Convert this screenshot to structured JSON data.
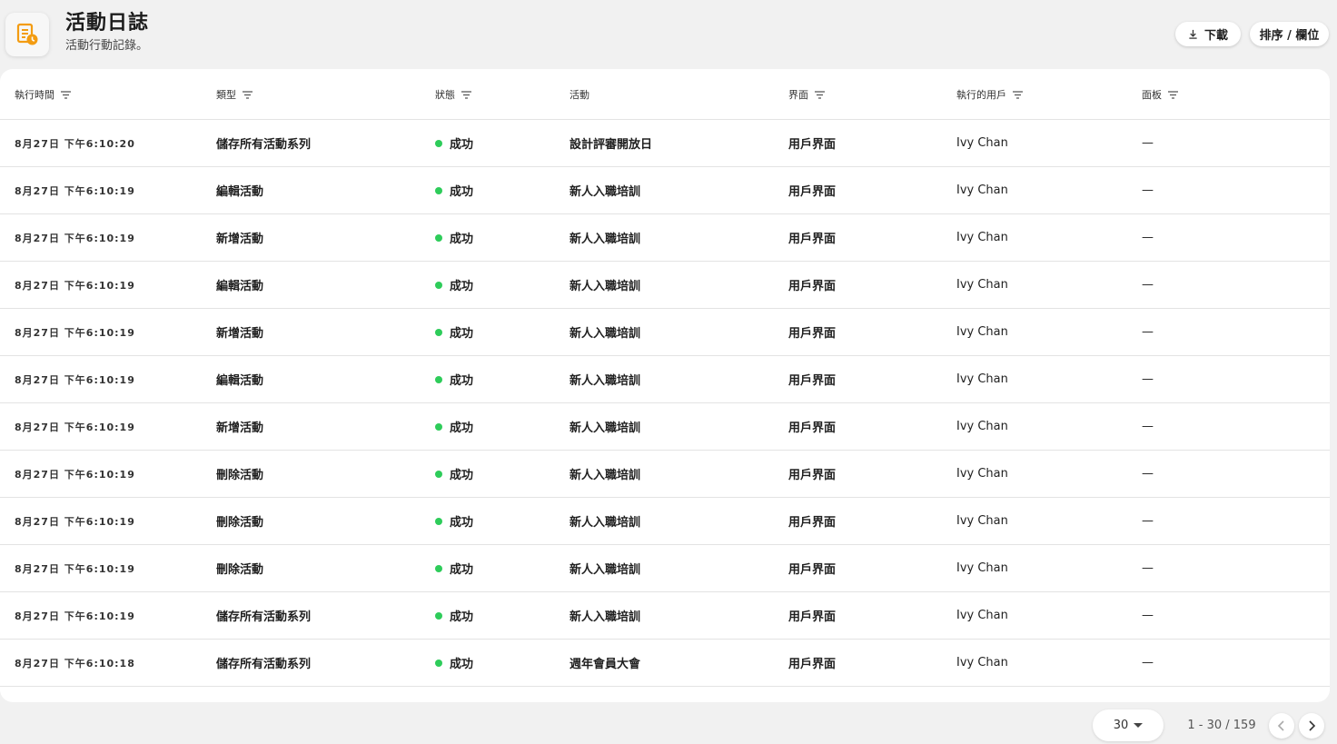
{
  "header": {
    "title": "活動日誌",
    "subtitle": "活動行動記錄。",
    "download_label": "下載",
    "sort_columns_label": "排序 / 欄位",
    "app_icon": "activity-log-icon",
    "accent_color": "#f39c12"
  },
  "table": {
    "columns": [
      "執行時間",
      "類型",
      "狀態",
      "活動",
      "界面",
      "執行的用戶",
      "面板"
    ],
    "status_color": "#2ecc5a",
    "rows": [
      {
        "time": "8月27日 下午6:10:20",
        "type": "儲存所有活動系列",
        "status": "成功",
        "activity": "設計評審開放日",
        "interface": "用戶界面",
        "user": "Ivy Chan",
        "panel": "—"
      },
      {
        "time": "8月27日 下午6:10:19",
        "type": "編輯活動",
        "status": "成功",
        "activity": "新人入職培訓",
        "interface": "用戶界面",
        "user": "Ivy Chan",
        "panel": "—"
      },
      {
        "time": "8月27日 下午6:10:19",
        "type": "新增活動",
        "status": "成功",
        "activity": "新人入職培訓",
        "interface": "用戶界面",
        "user": "Ivy Chan",
        "panel": "—"
      },
      {
        "time": "8月27日 下午6:10:19",
        "type": "編輯活動",
        "status": "成功",
        "activity": "新人入職培訓",
        "interface": "用戶界面",
        "user": "Ivy Chan",
        "panel": "—"
      },
      {
        "time": "8月27日 下午6:10:19",
        "type": "新增活動",
        "status": "成功",
        "activity": "新人入職培訓",
        "interface": "用戶界面",
        "user": "Ivy Chan",
        "panel": "—"
      },
      {
        "time": "8月27日 下午6:10:19",
        "type": "編輯活動",
        "status": "成功",
        "activity": "新人入職培訓",
        "interface": "用戶界面",
        "user": "Ivy Chan",
        "panel": "—"
      },
      {
        "time": "8月27日 下午6:10:19",
        "type": "新增活動",
        "status": "成功",
        "activity": "新人入職培訓",
        "interface": "用戶界面",
        "user": "Ivy Chan",
        "panel": "—"
      },
      {
        "time": "8月27日 下午6:10:19",
        "type": "刪除活動",
        "status": "成功",
        "activity": "新人入職培訓",
        "interface": "用戶界面",
        "user": "Ivy Chan",
        "panel": "—"
      },
      {
        "time": "8月27日 下午6:10:19",
        "type": "刪除活動",
        "status": "成功",
        "activity": "新人入職培訓",
        "interface": "用戶界面",
        "user": "Ivy Chan",
        "panel": "—"
      },
      {
        "time": "8月27日 下午6:10:19",
        "type": "刪除活動",
        "status": "成功",
        "activity": "新人入職培訓",
        "interface": "用戶界面",
        "user": "Ivy Chan",
        "panel": "—"
      },
      {
        "time": "8月27日 下午6:10:19",
        "type": "儲存所有活動系列",
        "status": "成功",
        "activity": "新人入職培訓",
        "interface": "用戶界面",
        "user": "Ivy Chan",
        "panel": "—"
      },
      {
        "time": "8月27日 下午6:10:18",
        "type": "儲存所有活動系列",
        "status": "成功",
        "activity": "週年會員大會",
        "interface": "用戶界面",
        "user": "Ivy Chan",
        "panel": "—"
      }
    ]
  },
  "pagination": {
    "page_size": "30",
    "range_text": "1 - 30 / 159"
  }
}
